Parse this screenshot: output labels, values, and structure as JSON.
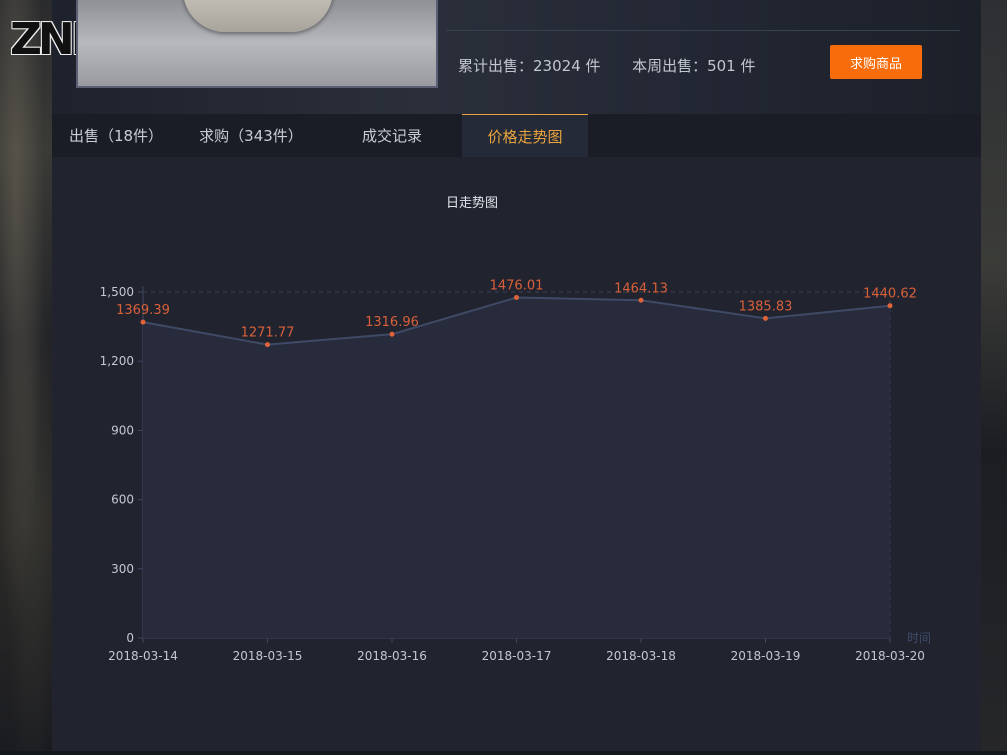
{
  "logo": {
    "text": "ZNI"
  },
  "stats": {
    "total_label": "累计出售：",
    "total_value": "23024",
    "total_unit": " 件",
    "week_label": "本周出售：",
    "week_value": "501",
    "week_unit": " 件"
  },
  "buy_button": {
    "label": "求购商品"
  },
  "tabs": [
    {
      "label": "出售（18件）",
      "active": false
    },
    {
      "label": "求购（343件）",
      "active": false
    },
    {
      "label": "成交记录",
      "active": false
    },
    {
      "label": "价格走势图",
      "active": true
    }
  ],
  "colors": {
    "accent": "#e8a33d",
    "button": "#f76d0b",
    "line": "#3f4a66",
    "point": "#e0633a",
    "label": "#d9603a"
  },
  "chart_data": {
    "type": "line",
    "title": "日走势图",
    "xlabel": "时间",
    "ylabel": "",
    "categories": [
      "2018-03-14",
      "2018-03-15",
      "2018-03-16",
      "2018-03-17",
      "2018-03-18",
      "2018-03-19",
      "2018-03-20"
    ],
    "values": [
      1369.39,
      1271.77,
      1316.96,
      1476.01,
      1464.13,
      1385.83,
      1440.62
    ],
    "value_labels": [
      "1369.39",
      "1271.77",
      "1316.96",
      "1476.01",
      "1464.13",
      "1385.83",
      "1440.62"
    ],
    "ylim": [
      0,
      1500
    ],
    "yticks": [
      0,
      300,
      600,
      900,
      1200,
      1500
    ],
    "ytick_labels": [
      "0",
      "300",
      "600",
      "900",
      "1,200",
      "1,500"
    ],
    "area_fill": true,
    "grid": false
  }
}
